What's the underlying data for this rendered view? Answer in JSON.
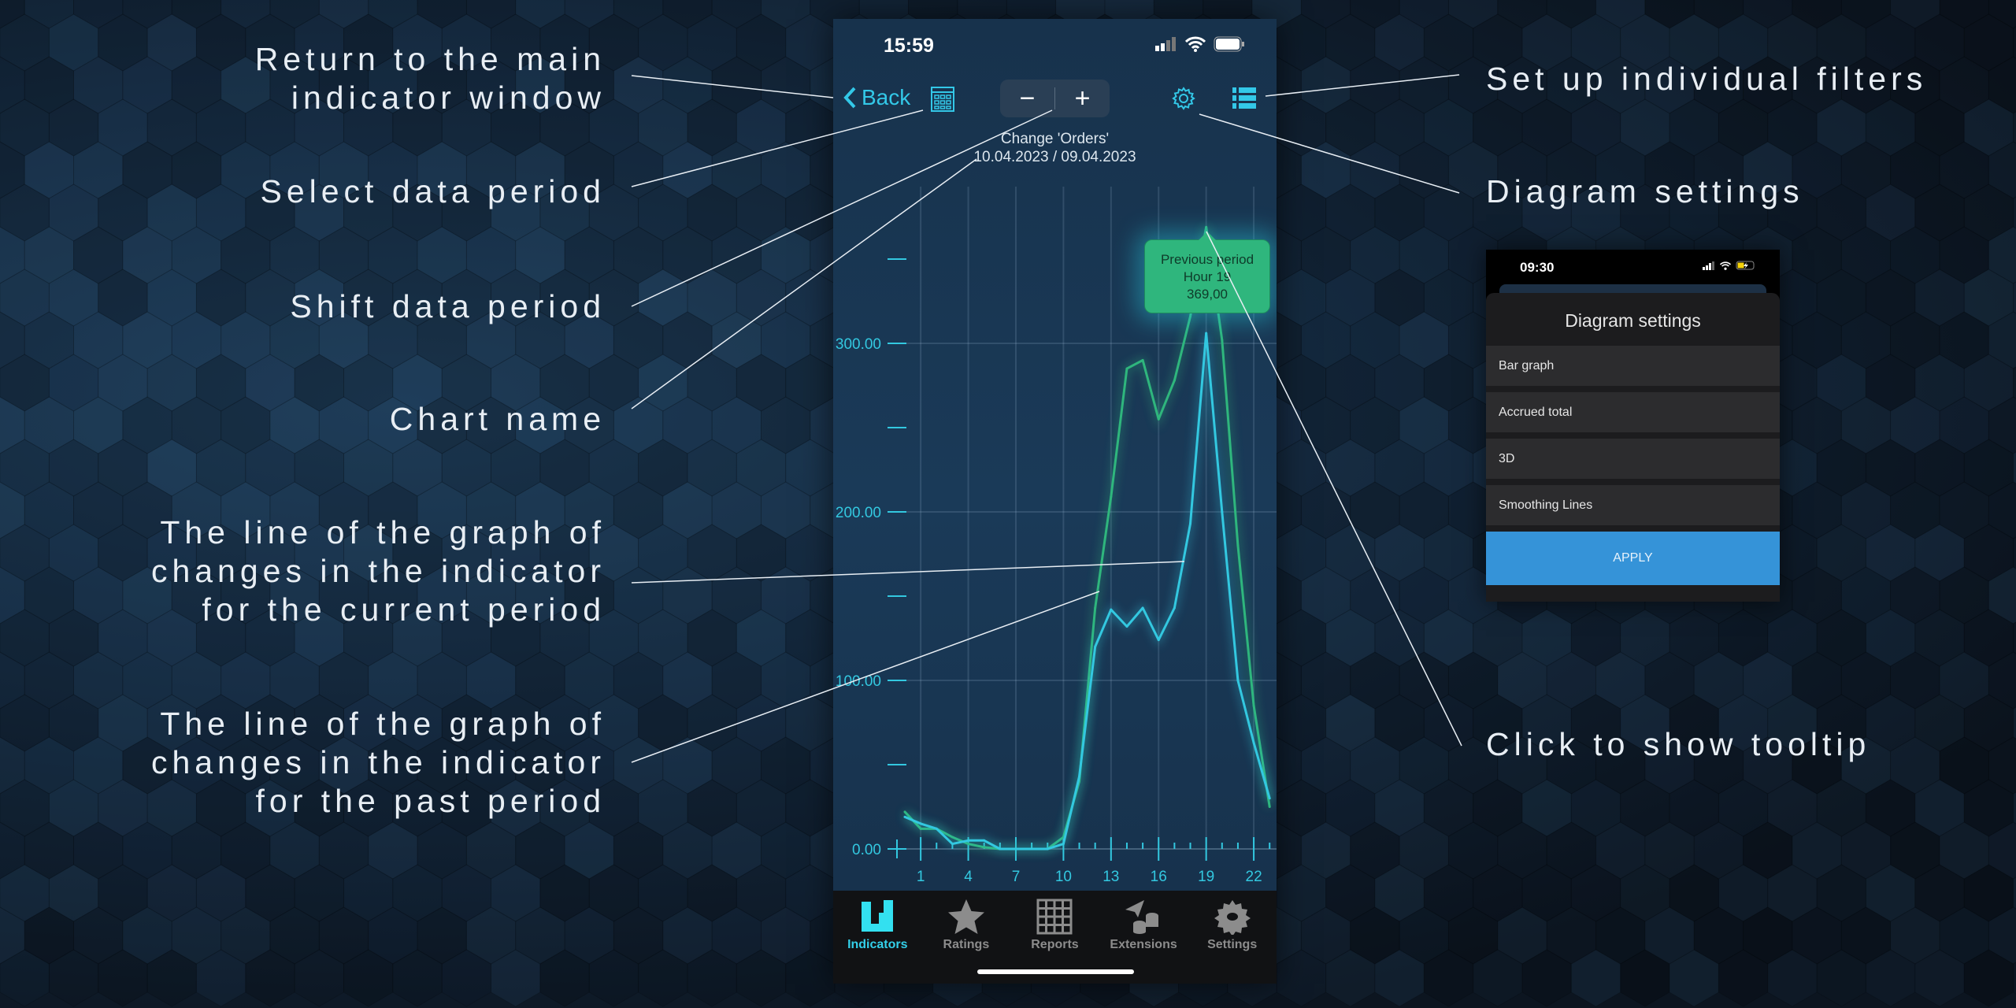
{
  "annotations": {
    "left": [
      {
        "lines": [
          "Return to the main",
          "indicator window"
        ]
      },
      {
        "lines": [
          "Select data period"
        ]
      },
      {
        "lines": [
          "Shift data period"
        ]
      },
      {
        "lines": [
          "Chart name"
        ]
      },
      {
        "lines": [
          "The line of the graph of",
          "changes in the indicator",
          "for the current period"
        ]
      },
      {
        "lines": [
          "The line of the graph of",
          "changes in the indicator",
          "for the past period"
        ]
      }
    ],
    "right": [
      {
        "lines": [
          "Set up individual filters"
        ]
      },
      {
        "lines": [
          "Diagram settings"
        ]
      },
      {
        "lines": [
          "Click to show tooltip"
        ]
      }
    ]
  },
  "phone": {
    "status_time": "15:59",
    "back_label": "Back",
    "stepper": {
      "minus": "−",
      "plus": "+"
    },
    "icons": [
      "chevron-left-icon",
      "calendar-icon",
      "gear-icon",
      "list-icon"
    ],
    "chart_title": "Change 'Orders'",
    "chart_dates": "10.04.2023 / 09.04.2023",
    "tooltip": {
      "line1": "Previous period",
      "line2": "Hour 19",
      "line3": "369,00"
    },
    "tabs": [
      {
        "label": "Indicators",
        "icon": "indicators-icon",
        "active": true
      },
      {
        "label": "Ratings",
        "icon": "star-icon",
        "active": false
      },
      {
        "label": "Reports",
        "icon": "grid-icon",
        "active": false
      },
      {
        "label": "Extensions",
        "icon": "extensions-icon",
        "active": false
      },
      {
        "label": "Settings",
        "icon": "gear-icon",
        "active": false
      }
    ]
  },
  "settings_panel": {
    "status_time": "09:30",
    "title": "Diagram settings",
    "options": [
      "Bar graph",
      "Accrued total",
      "3D",
      "Smoothing Lines"
    ],
    "apply_label": "APPLY"
  },
  "colors": {
    "current": "#33c8e0",
    "previous": "#2fb67d",
    "accent": "#33c8e8",
    "apply": "#3593d8"
  },
  "chart_data": {
    "type": "line",
    "x": [
      0,
      1,
      2,
      3,
      4,
      5,
      6,
      7,
      8,
      9,
      10,
      11,
      12,
      13,
      14,
      15,
      16,
      17,
      18,
      19,
      20,
      21,
      22,
      23
    ],
    "series": [
      {
        "role": "current period",
        "color": "#33c8e0",
        "values": [
          19,
          15,
          12,
          3,
          5,
          5,
          0,
          0,
          0,
          0,
          3,
          43,
          120,
          142,
          132,
          143,
          124,
          143,
          193,
          306,
          200,
          100,
          63,
          30
        ]
      },
      {
        "role": "previous period",
        "color": "#2fb67d",
        "values": [
          22,
          12,
          12,
          7,
          3,
          1,
          0,
          0,
          0,
          0,
          7,
          40,
          143,
          209,
          285,
          290,
          255,
          278,
          316,
          369,
          302,
          180,
          85,
          25
        ]
      }
    ],
    "xticks": [
      "1",
      "4",
      "7",
      "10",
      "13",
      "16",
      "19",
      "22"
    ],
    "xtick_values": [
      1,
      4,
      7,
      10,
      13,
      16,
      19,
      22
    ],
    "yticks": [
      "0.00",
      "100.00",
      "200.00",
      "300.00"
    ],
    "ytick_values": [
      0,
      100,
      200,
      300
    ],
    "ylim": [
      0,
      350
    ],
    "xlim": [
      0,
      23
    ],
    "grid": true
  }
}
